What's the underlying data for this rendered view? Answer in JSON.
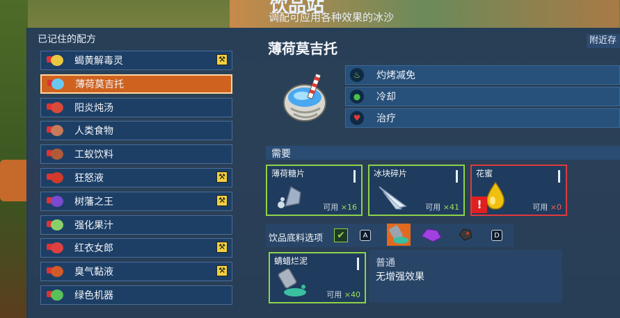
{
  "header": {
    "title": "饮品站",
    "subtitle": "调配可应用各种效果的冰沙"
  },
  "recipes": {
    "label": "已记住的配方",
    "items": [
      {
        "label": "蝎黄解毒灵",
        "hammer": true,
        "color": "#e8c840"
      },
      {
        "label": "薄荷莫吉托",
        "hammer": false,
        "color": "#6ac8f0"
      },
      {
        "label": "阳炎炖汤",
        "hammer": false,
        "color": "#d84a3a"
      },
      {
        "label": "人类食物",
        "hammer": false,
        "color": "#c87a5a"
      },
      {
        "label": "工蚁饮料",
        "hammer": false,
        "color": "#b05a3a"
      },
      {
        "label": "狂怒液",
        "hammer": true,
        "color": "#d03a2a"
      },
      {
        "label": "树藩之王",
        "hammer": true,
        "color": "#7a4ad0"
      },
      {
        "label": "强化果汁",
        "hammer": false,
        "color": "#8ad06a"
      },
      {
        "label": " 红衣女郎",
        "hammer": true,
        "color": "#e04040"
      },
      {
        "label": "臭气黏液",
        "hammer": true,
        "color": "#d05a2a"
      },
      {
        "label": "绿色机器",
        "hammer": false,
        "color": "#5ac05a"
      }
    ],
    "selected_index": 1
  },
  "nearby_label": "附近存",
  "detail": {
    "title": "薄荷莫吉托",
    "effects": [
      {
        "label": "灼烤减免",
        "icon": "heat-icon",
        "color": "#8fd34a"
      },
      {
        "label": "冷却",
        "icon": "droplet-icon",
        "color": "#4ac04a"
      },
      {
        "label": "治疗",
        "icon": "heart-icon",
        "color": "#e03a3a"
      }
    ]
  },
  "needs": {
    "label": "需要",
    "ingredients": [
      {
        "name": "薄荷糖片",
        "available_label": "可用",
        "count": "×16",
        "sufficient": true
      },
      {
        "name": "冰块碎片",
        "available_label": "可用",
        "count": "×41",
        "sufficient": true
      },
      {
        "name": "花蜜",
        "available_label": "可用",
        "count": "×0",
        "sufficient": false,
        "warning": "!"
      }
    ]
  },
  "base": {
    "label": "饮品底料选项",
    "key_left": "A",
    "key_right": "D",
    "selected": {
      "name": "蜻蜡烂泥",
      "available_label": "可用",
      "count": "×40",
      "quality": "普通",
      "effect_text": "无增强效果"
    }
  },
  "colors": {
    "accent": "#d0621f",
    "ok": "#8fd34a",
    "bad": "#e03a3a",
    "panel": "#213a58"
  }
}
